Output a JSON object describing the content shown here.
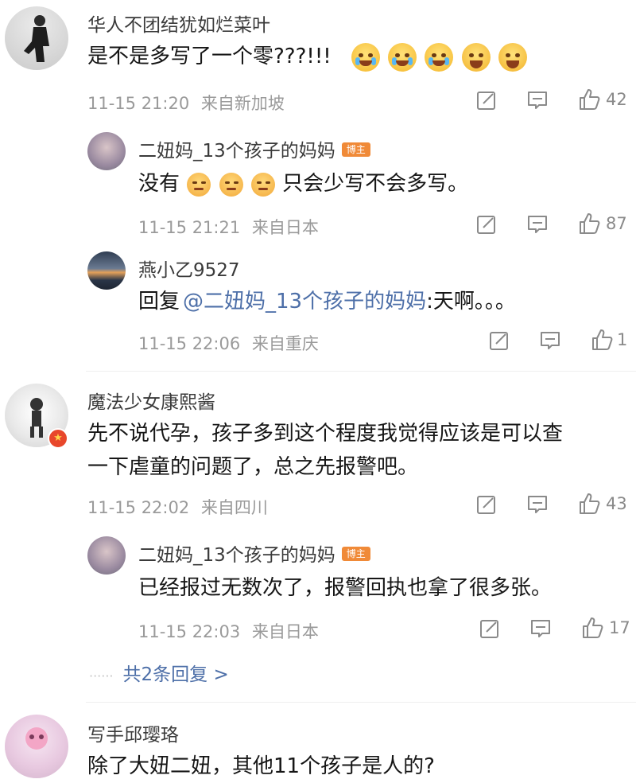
{
  "comments": [
    {
      "username": "华人不团结犹如烂菜叶",
      "text": "是不是多写了一个零???!!!",
      "emojis": [
        "cry",
        "cry",
        "cry",
        "laugh",
        "laugh"
      ],
      "time": "11-15 21:20",
      "location": "来自新加坡",
      "likes": "42"
    },
    {
      "username": "二妞妈_13个孩子的妈妈",
      "badge": "博主",
      "text_pre": "没有",
      "text_post": "只会少写不会多写。",
      "emojis": [
        "meh",
        "meh",
        "meh"
      ],
      "time": "11-15 21:21",
      "location": "来自日本",
      "likes": "87"
    },
    {
      "username": "燕小乙9527",
      "reply_prefix": "回复",
      "mention": "@二妞妈_13个孩子的妈妈",
      "reply_text": ":天啊。。。",
      "time": "11-15 22:06",
      "location": "来自重庆",
      "likes": "1"
    },
    {
      "username": "魔法少女康熙酱",
      "text_line1": "先不说代孕，孩子多到这个程度我觉得应该是可以查",
      "text_line2": "一下虐童的问题了，总之先报警吧。",
      "time": "11-15 22:02",
      "location": "来自四川",
      "likes": "43"
    },
    {
      "username": "二妞妈_13个孩子的妈妈",
      "badge": "博主",
      "text": "已经报过无数次了，报警回执也拿了很多张。",
      "time": "11-15 22:03",
      "location": "来自日本",
      "likes": "17"
    },
    {
      "username": "写手邱璎珞",
      "text": "除了大妞二妞，其他11个孩子是人的?"
    }
  ],
  "expand_replies": "共2条回复 >",
  "icons": {
    "share": "share-icon",
    "comment": "comment-icon",
    "like": "thumbs-up-icon"
  }
}
